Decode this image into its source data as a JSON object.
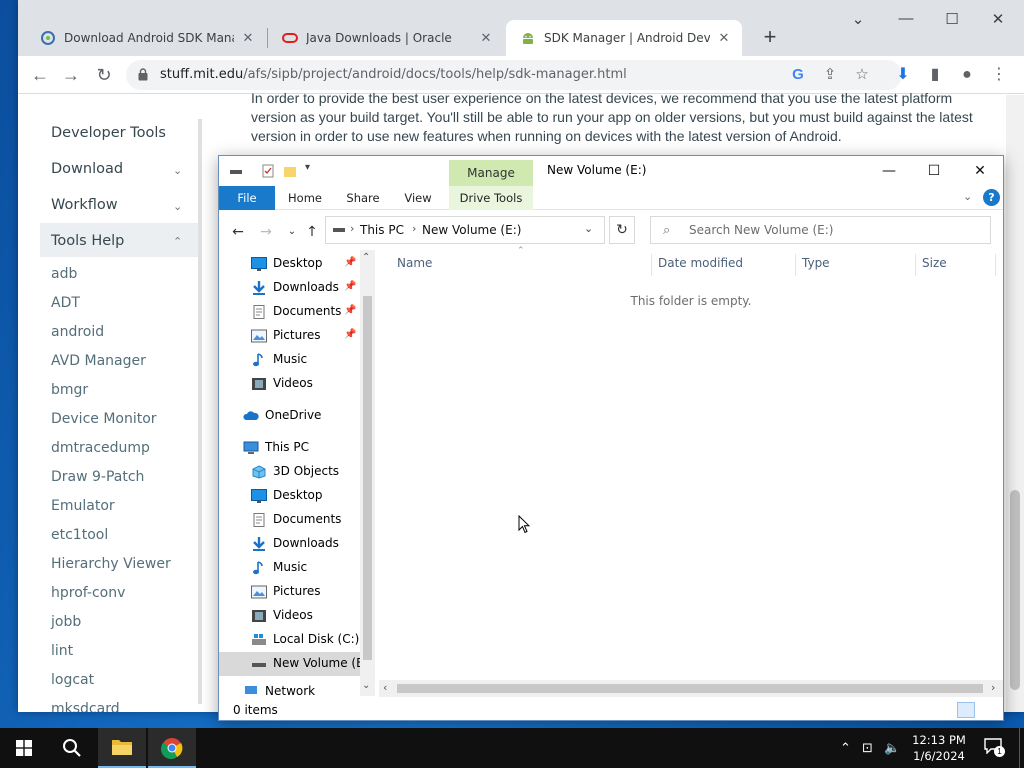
{
  "browser": {
    "tabs": [
      {
        "label": "Download Android SDK Manager",
        "icon": "android-studio-icon"
      },
      {
        "label": "Java Downloads | Oracle",
        "icon": "oracle-icon"
      },
      {
        "label": "SDK Manager | Android Developers",
        "icon": "android-icon",
        "active": true
      }
    ],
    "url_host": "stuff.mit.edu",
    "url_path": "/afs/sipb/project/android/docs/tools/help/sdk-manager.html"
  },
  "page": {
    "intro_text": "In order to provide the best user experience on the latest devices, we recommend that you use the latest platform version as your build target. You'll still be able to run your app on older versions, but you must build against the latest version in order to use new features when running on devices with the latest version of Android.",
    "sidenav": {
      "top": [
        "Developer Tools",
        "Download",
        "Workflow",
        "Tools Help"
      ],
      "sub": [
        "adb",
        "ADT",
        "android",
        "AVD Manager",
        "bmgr",
        "Device Monitor",
        "dmtracedump",
        "Draw 9-Patch",
        "Emulator",
        "etc1tool",
        "Hierarchy Viewer",
        "hprof-conv",
        "jobb",
        "lint",
        "logcat",
        "mksdcard"
      ]
    }
  },
  "explorer": {
    "window_title": "New Volume (E:)",
    "ribbon": {
      "context_group": "Manage",
      "tabs": [
        "File",
        "Home",
        "Share",
        "View",
        "Drive Tools"
      ]
    },
    "address": [
      "This PC",
      "New Volume (E:)"
    ],
    "search_placeholder": "Search New Volume (E:)",
    "nav_items": [
      {
        "label": "Desktop",
        "icon": "desktop-icon",
        "pinned": true
      },
      {
        "label": "Downloads",
        "icon": "downloads-icon",
        "pinned": true
      },
      {
        "label": "Documents",
        "icon": "documents-icon",
        "pinned": true
      },
      {
        "label": "Pictures",
        "icon": "pictures-icon",
        "pinned": true
      },
      {
        "label": "Music",
        "icon": "music-icon"
      },
      {
        "label": "Videos",
        "icon": "videos-icon"
      },
      {
        "label": "OneDrive",
        "icon": "onedrive-icon"
      },
      {
        "label": "This PC",
        "icon": "this-pc-icon"
      },
      {
        "label": "3D Objects",
        "icon": "3d-objects-icon"
      },
      {
        "label": "Desktop",
        "icon": "desktop-icon"
      },
      {
        "label": "Documents",
        "icon": "documents-icon"
      },
      {
        "label": "Downloads",
        "icon": "downloads-icon"
      },
      {
        "label": "Music",
        "icon": "music-icon"
      },
      {
        "label": "Pictures",
        "icon": "pictures-icon"
      },
      {
        "label": "Videos",
        "icon": "videos-icon"
      },
      {
        "label": "Local Disk (C:)",
        "icon": "drive-icon"
      },
      {
        "label": "New Volume (E:)",
        "icon": "drive-icon",
        "selected": true
      },
      {
        "label": "Network",
        "icon": "network-icon"
      }
    ],
    "columns": [
      "Name",
      "Date modified",
      "Type",
      "Size"
    ],
    "empty_message": "This folder is empty.",
    "status": "0 items"
  },
  "taskbar": {
    "time": "12:13 PM",
    "date": "1/6/2024",
    "notification_count": "1"
  },
  "colors": {
    "accent": "#1979ca",
    "manage_green": "#cfe9b0",
    "taskbar": "#101010"
  }
}
